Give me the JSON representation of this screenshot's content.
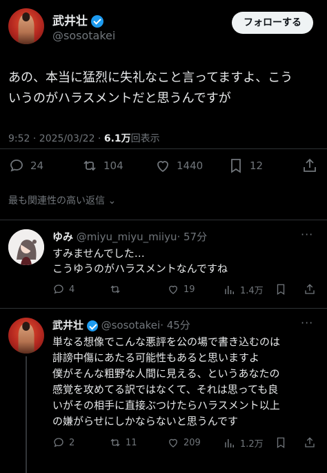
{
  "main_tweet": {
    "author_name": "武井壮",
    "author_handle": "@sosotakei",
    "follow_label": "フォローする",
    "text_line1": "あの、本当に猛烈に失礼なこと言ってますよ、こう",
    "text_line2": "いうのがハラスメントだと思うんですが",
    "time": "9:52 · 2025/03/22 · ",
    "views_count": "6.1万",
    "views_label": "回表示",
    "reply_count": "24",
    "retweet_count": "104",
    "like_count": "1440",
    "bookmark_count": "12"
  },
  "sort_label": "最も関連性の高い返信",
  "reply1": {
    "author_name": "ゆみ",
    "author_handle": "@miyu_miyu_miiyu",
    "time": "· 57分",
    "text_line1": "すみませんでした…",
    "text_line2": "こうゆうのがハラスメントなんですね",
    "reply_count": "4",
    "retweet_count": "",
    "like_count": "19",
    "views_count": "1.4万"
  },
  "reply2": {
    "author_name": "武井壮",
    "author_handle": "@sosotakei",
    "time": "· 45分",
    "lines": [
      "単なる想像でこんな悪評を公の場で書き込むのは",
      "誹謗中傷にあたる可能性もあると思いますよ",
      "僕がそんな粗野な人間に見える、というあなたの",
      "感覚を攻めてる訳ではなくて、それは思っても良",
      "いがその相手に直接ぶつけたらハラスメント以上",
      "の嫌がらせにしかならないと思うんです"
    ],
    "reply_count": "2",
    "retweet_count": "11",
    "like_count": "209",
    "views_count": "1.2万"
  },
  "colors": {
    "accent": "#1d9bf0",
    "muted": "#71767b",
    "background": "#000000"
  }
}
